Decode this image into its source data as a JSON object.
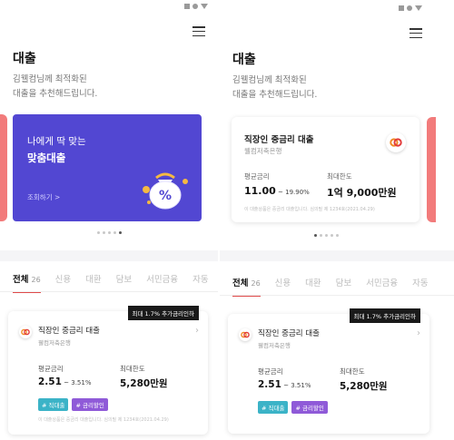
{
  "colors": {
    "accent": "#e04a4a",
    "promo_bg": "#5247d2",
    "tag_cyan": "#3bb3c7",
    "tag_purple": "#8f5ad8",
    "badge_bg": "#1a1a1a"
  },
  "screen1": {
    "title": "대출",
    "subtitle_line1": "김웰컴님께 최적화된",
    "subtitle_line2": "대출을 추천해드립니다.",
    "promo": {
      "line1": "나에게 딱 맞는",
      "line2": "맞춤대출",
      "link": "조회하기 >"
    },
    "tabs": [
      {
        "label": "전체",
        "count": "26"
      },
      {
        "label": "신용"
      },
      {
        "label": "대환"
      },
      {
        "label": "담보"
      },
      {
        "label": "서민금융"
      },
      {
        "label": "자동"
      }
    ],
    "card": {
      "badge": "최대 1.7% 추가금리인하",
      "name": "직장인 중금리 대출",
      "bank": "웰컴저축은행",
      "rate_label": "평균금리",
      "rate_main": "2.51",
      "rate_rest": " ~ 3.51%",
      "limit_label": "최대한도",
      "limit_value": "5,280만원",
      "tags": [
        "# 직대출",
        "# 금리할인"
      ],
      "note": "이 대출상품은 중금리 대출입니다. 심의필 제 1234호(2021.04.29)"
    }
  },
  "screen2": {
    "title": "대출",
    "subtitle_line1": "김웰컴님께 최적화된",
    "subtitle_line2": "대출을 추천해드립니다.",
    "featured": {
      "name": "직장인 중금리 대출",
      "bank": "웰컴저축은행",
      "rate_label": "평균금리",
      "rate_value": "11.00",
      "rate_rest": " ~ 19.90%",
      "limit_label": "최대한도",
      "limit_value": "1억 9,000만원",
      "note": "이 대출상품은 중금리 대출입니다. 심의필 제 1234호(2021.04.29)"
    },
    "tabs": [
      {
        "label": "전체",
        "count": "26"
      },
      {
        "label": "신용"
      },
      {
        "label": "대환"
      },
      {
        "label": "담보"
      },
      {
        "label": "서민금융"
      },
      {
        "label": "자동"
      }
    ],
    "card": {
      "badge": "최대 1.7% 추가금리인하",
      "name": "직장인 중금리 대출",
      "bank": "웰컴저축은행",
      "rate_label": "평균금리",
      "rate_main": "2.51",
      "rate_rest": " ~ 3.51%",
      "limit_label": "최대한도",
      "limit_value": "5,280만원",
      "tags": [
        "# 직대출",
        "# 금리할인"
      ]
    }
  }
}
